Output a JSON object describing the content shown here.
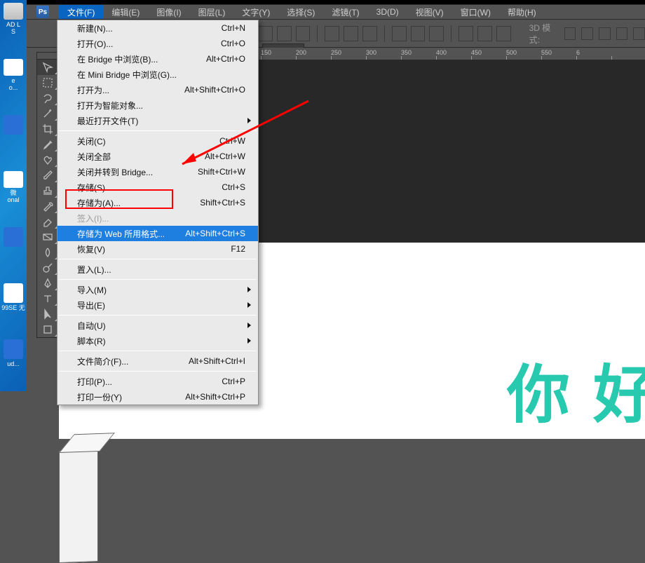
{
  "desktop": {
    "icons": [
      {
        "label": "AD L\nS"
      },
      {
        "label": "e\no..."
      },
      {
        "label": ""
      },
      {
        "label": "微\nonal"
      },
      {
        "label": ""
      },
      {
        "label": ""
      },
      {
        "label": "99SE 无"
      },
      {
        "label": ""
      },
      {
        "label": "ud..."
      },
      {
        "label": ""
      }
    ]
  },
  "menubar": {
    "items": [
      {
        "label": "文件(F)",
        "open": true
      },
      {
        "label": "编辑(E)"
      },
      {
        "label": "图像(I)"
      },
      {
        "label": "图层(L)"
      },
      {
        "label": "文字(Y)"
      },
      {
        "label": "选择(S)"
      },
      {
        "label": "滤镜(T)"
      },
      {
        "label": "3D(D)"
      },
      {
        "label": "视图(V)"
      },
      {
        "label": "窗口(W)"
      },
      {
        "label": "帮助(H)"
      }
    ]
  },
  "options": {
    "mode_label": "3D 模式:"
  },
  "ruler": {
    "ticks": [
      "150",
      "200",
      "250",
      "300",
      "350",
      "400",
      "450",
      "500",
      "550",
      "6"
    ]
  },
  "canvas": {
    "artwork_text": "你 好"
  },
  "dropdown": {
    "items": [
      {
        "label": "新建(N)...",
        "shortcut": "Ctrl+N"
      },
      {
        "label": "打开(O)...",
        "shortcut": "Ctrl+O"
      },
      {
        "label": "在 Bridge 中浏览(B)...",
        "shortcut": "Alt+Ctrl+O"
      },
      {
        "label": "在 Mini Bridge 中浏览(G)..."
      },
      {
        "label": "打开为...",
        "shortcut": "Alt+Shift+Ctrl+O"
      },
      {
        "label": "打开为智能对象..."
      },
      {
        "label": "最近打开文件(T)",
        "submenu": true
      },
      {
        "sep": true
      },
      {
        "label": "关闭(C)",
        "shortcut": "Ctrl+W"
      },
      {
        "label": "关闭全部",
        "shortcut": "Alt+Ctrl+W"
      },
      {
        "label": "关闭并转到 Bridge...",
        "shortcut": "Shift+Ctrl+W"
      },
      {
        "label": "存储(S)",
        "shortcut": "Ctrl+S"
      },
      {
        "label": "存储为(A)...",
        "shortcut": "Shift+Ctrl+S"
      },
      {
        "label": "签入(I)...",
        "disabled": true
      },
      {
        "label": "存储为 Web 所用格式...",
        "shortcut": "Alt+Shift+Ctrl+S",
        "highlight": true
      },
      {
        "label": "恢复(V)",
        "shortcut": "F12"
      },
      {
        "sep": true
      },
      {
        "label": "置入(L)..."
      },
      {
        "sep": true
      },
      {
        "label": "导入(M)",
        "submenu": true
      },
      {
        "label": "导出(E)",
        "submenu": true
      },
      {
        "sep": true
      },
      {
        "label": "自动(U)",
        "submenu": true
      },
      {
        "label": "脚本(R)",
        "submenu": true
      },
      {
        "sep": true
      },
      {
        "label": "文件简介(F)...",
        "shortcut": "Alt+Shift+Ctrl+I"
      },
      {
        "sep": true
      },
      {
        "label": "打印(P)...",
        "shortcut": "Ctrl+P"
      },
      {
        "label": "打印一份(Y)",
        "shortcut": "Alt+Shift+Ctrl+P"
      }
    ]
  }
}
